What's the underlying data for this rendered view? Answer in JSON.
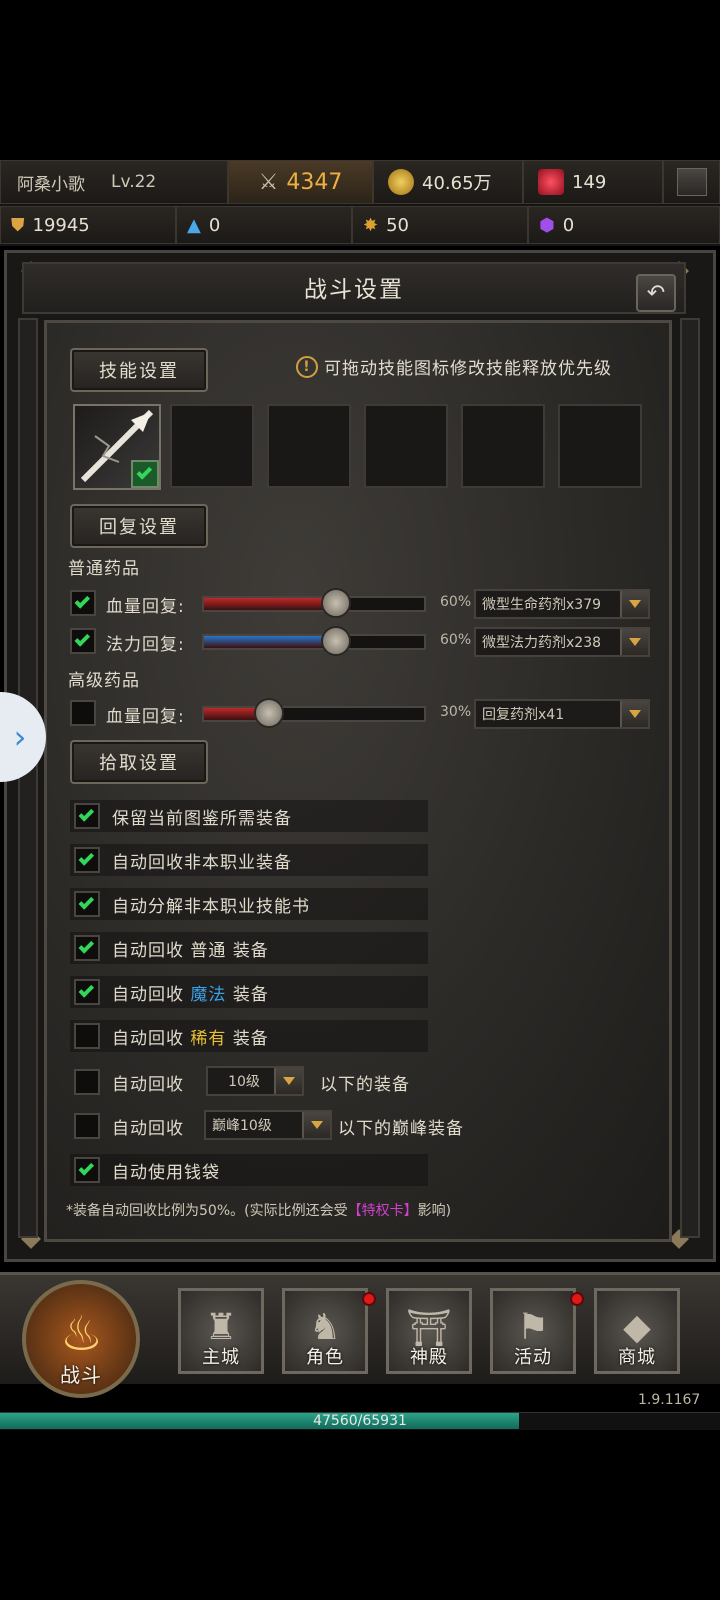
{
  "player": {
    "name": "阿桑小歌",
    "level": "Lv.22"
  },
  "resources": {
    "power": "4347",
    "gold": "40.65万",
    "gems": "149",
    "r1": "19945",
    "r2": "0",
    "r3": "50",
    "r4": "0"
  },
  "panel": {
    "title": "战斗设置"
  },
  "skills": {
    "section_label": "技能设置",
    "hint": "可拖动技能图标修改技能释放优先级",
    "hint_icon": "!"
  },
  "recovery": {
    "section_label": "回复设置",
    "normal_title": "普通药品",
    "advanced_title": "高级药品",
    "rows": [
      {
        "label": "血量回复:",
        "checked": true,
        "percent_text": "60%",
        "value": 0.6,
        "item": "微型生命药剂x379",
        "color": "#c0282a"
      },
      {
        "label": "法力回复:",
        "checked": true,
        "percent_text": "60%",
        "value": 0.6,
        "item": "微型法力药剂x238",
        "color": "#2a74c8"
      },
      {
        "label": "血量回复:",
        "checked": false,
        "percent_text": "30%",
        "value": 0.3,
        "item": "回复药剂x41",
        "color": "#c0282a"
      }
    ]
  },
  "pickup": {
    "section_label": "拾取设置",
    "options": [
      {
        "text": "保留当前图鉴所需装备",
        "checked": true
      },
      {
        "text": "自动回收非本职业装备",
        "checked": true
      },
      {
        "text": "自动分解非本职业技能书",
        "checked": true
      },
      {
        "prefix": "自动回收",
        "quality": "普通",
        "suffix": "装备",
        "quality_color": "#e0dacb",
        "checked": true
      },
      {
        "prefix": "自动回收",
        "quality": "魔法",
        "suffix": "装备",
        "quality_color": "#3aa0e8",
        "checked": true
      },
      {
        "prefix": "自动回收",
        "quality": "稀有",
        "suffix": "装备",
        "quality_color": "#e8c030",
        "checked": false
      }
    ],
    "level_option": {
      "prefix": "自动回收",
      "select": "10级",
      "suffix": "以下的装备",
      "checked": false
    },
    "peak_option": {
      "prefix": "自动回收",
      "select": "巅峰10级",
      "suffix": "以下的巅峰装备",
      "checked": false
    },
    "wallet_option": {
      "text": "自动使用钱袋",
      "checked": true
    }
  },
  "footnote": {
    "before": "*装备自动回收比例为50%。(实际比例还会受",
    "privilege": "【特权卡】",
    "after": "影响)"
  },
  "nav": {
    "battle": "战斗",
    "city": "主城",
    "role": "角色",
    "temple": "神殿",
    "activity": "活动",
    "shop": "商城"
  },
  "version": "1.9.1167",
  "exp": {
    "text": "47560/65931",
    "current": 47560,
    "max": 65931
  }
}
